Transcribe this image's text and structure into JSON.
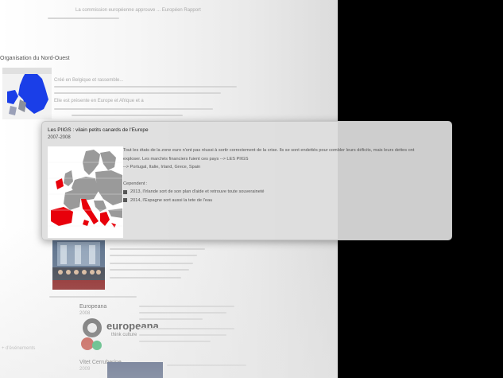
{
  "background_page": {
    "top_link": "La commission européenne approuve ... Européen Rapport",
    "section1_title": "Organisation du Nord-Ouest",
    "section1_text": [
      "Créé en Belgique et rassemble...",
      "Elle est présente en Europe et Afrique et a"
    ],
    "section2_title": "Europeana",
    "section2_date": "2008",
    "section2_logo_text": "europeana",
    "section2_logo_subtext": "think culture",
    "section3_title": "Vitet Cerruberine",
    "section3_date": "2009",
    "left_edge_text": "+ d'événements"
  },
  "card": {
    "title": "Les PIIGS : vilain petits canards de l'Europe",
    "date": "2007-2008",
    "paragraph1": "Tout les états de la zone euro n'ont pas réussi à sortir correctement de la crise. Ils se sont endettés pour combler leurs déficits, mais leurs dettes ont",
    "paragraph1_line2": "exploser. Les marchés financiers fuient ces pays --> LES PIIGS",
    "paragraph1_line3": "--> Portugal, Italie, Irland, Grece, Spain",
    "cependant": "Cependent :",
    "bullets": [
      "2013, l'Irlande sort de son plan d'aide et retrouve toute souveraineté",
      "2014, l'Espagne sort aussi la tete de l'eau"
    ],
    "map_icon": "europe-map-highlighted-piigs",
    "highlight_color": "#e8000b"
  },
  "colors": {
    "background_right": "#000000",
    "card_bg": "#dedede",
    "blue_map": "#1a3ee8"
  }
}
